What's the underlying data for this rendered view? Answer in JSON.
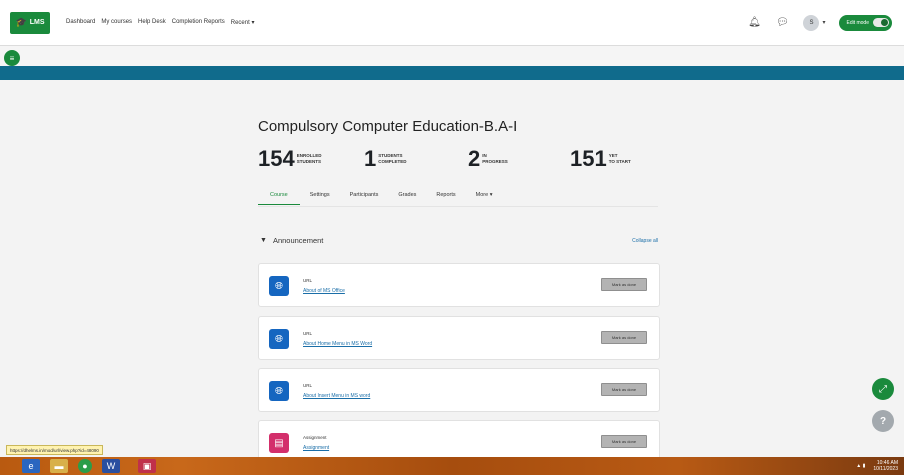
{
  "navbar": {
    "brand": "LMS",
    "links": [
      "Dashboard",
      "My courses",
      "Help Desk",
      "Completion Reports",
      "Recent ▾"
    ],
    "avatar_initial": "S",
    "edit_mode_label": "Edit mode"
  },
  "course": {
    "title": "Compulsory Computer Education-B.A-I",
    "stats": [
      {
        "value": "154",
        "line1": "ENROLLED",
        "line2": "STUDENTS"
      },
      {
        "value": "1",
        "line1": "STUDENTS",
        "line2": "COMPLETED"
      },
      {
        "value": "2",
        "line1": "IN",
        "line2": "PROGRESS"
      },
      {
        "value": "151",
        "line1": "YET",
        "line2": "TO START"
      }
    ],
    "tabs": [
      "Course",
      "Settings",
      "Participants",
      "Grades",
      "Reports",
      "More ▾"
    ]
  },
  "section": {
    "title": "Announcement",
    "collapse_label": "Collapse all"
  },
  "activities": [
    {
      "type": "URL",
      "name": "About of MS Office",
      "button": "Mark as done"
    },
    {
      "type": "URL",
      "name": "About Home Menu in MS Word",
      "button": "Mark as done"
    },
    {
      "type": "URL",
      "name": "About Insert Menu in MS word",
      "button": "Mark as done"
    },
    {
      "type": "Assignment",
      "name": "Assignment",
      "button": "Mark as done"
    }
  ],
  "status_url": "https://dhelms.in/mod/url/view.php?id=48090",
  "clock": {
    "time": "10:46 AM",
    "date": "10/11/2023"
  },
  "colors": {
    "brand_green": "#1a8a3c",
    "band_blue": "#106b8c",
    "link_blue": "#1a6ea8"
  }
}
